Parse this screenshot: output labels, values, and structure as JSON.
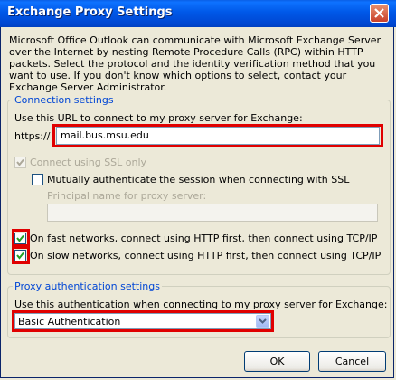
{
  "window": {
    "title": "Exchange Proxy Settings"
  },
  "intro_text": "Microsoft Office Outlook can communicate with Microsoft Exchange Server over the Internet by nesting Remote Procedure Calls (RPC) within HTTP packets.  Select the protocol and the identity verification method that you want to use.  If you don't know which options to select, contact your Exchange Server Administrator.",
  "connection": {
    "legend": "Connection settings",
    "url_label": "Use this URL to connect to my proxy server for Exchange:",
    "url_prefix": "https://",
    "url_value": "mail.bus.msu.edu",
    "ssl_label": "Connect using SSL only",
    "ssl_checked": true,
    "mutual_label": "Mutually authenticate the session when connecting with SSL",
    "mutual_checked": false,
    "principal_label": "Principal name for proxy server:",
    "principal_value": "",
    "fast_label": "On fast networks, connect using HTTP first, then connect using TCP/IP",
    "fast_checked": true,
    "slow_label": "On slow networks, connect using HTTP first, then connect using TCP/IP",
    "slow_checked": true
  },
  "auth": {
    "legend": "Proxy authentication settings",
    "label": "Use this authentication when connecting to my proxy server for Exchange:",
    "selected": "Basic Authentication"
  },
  "buttons": {
    "ok": "OK",
    "cancel": "Cancel"
  },
  "colors": {
    "highlight": "#e00000",
    "legend": "#0046d5",
    "title_bar": "#0058e8"
  }
}
